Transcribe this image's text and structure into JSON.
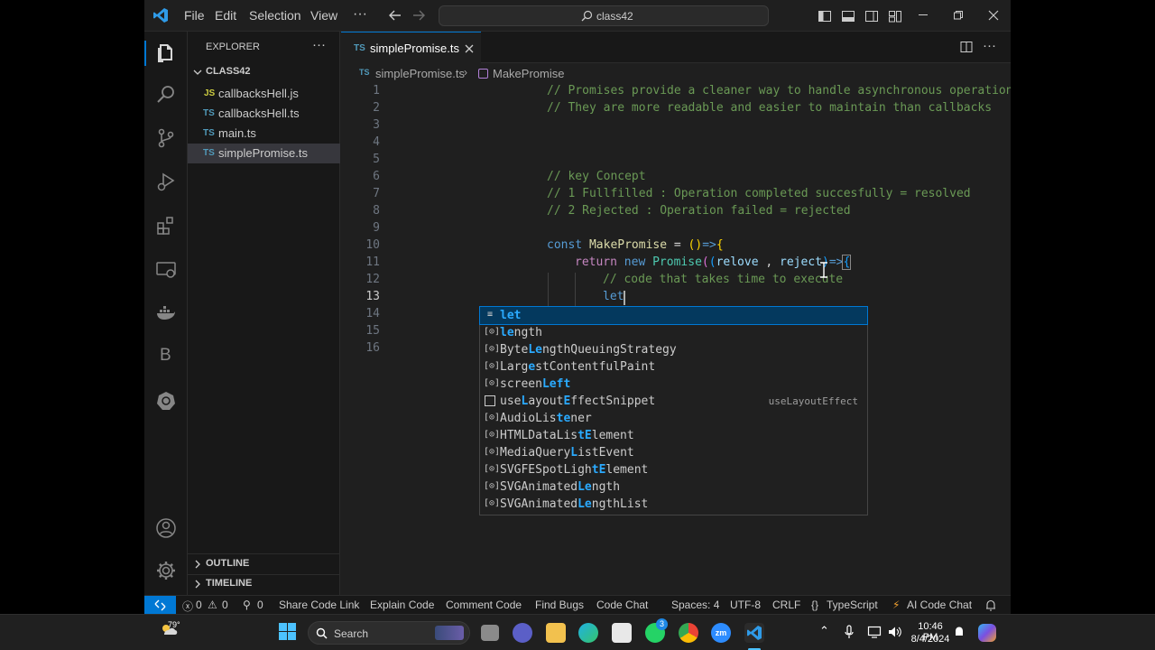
{
  "menu": [
    "File",
    "Edit",
    "Selection",
    "View"
  ],
  "command_center": "class42",
  "explorer": {
    "title": "EXPLORER",
    "folder": "CLASS42",
    "files": [
      {
        "badge": "JS",
        "name": "callbacksHell.js",
        "color": "#cbcb41"
      },
      {
        "badge": "TS",
        "name": "callbacksHell.ts",
        "color": "#519aba"
      },
      {
        "badge": "TS",
        "name": "main.ts",
        "color": "#519aba"
      },
      {
        "badge": "TS",
        "name": "simplePromise.ts",
        "color": "#519aba"
      }
    ],
    "outline": "OUTLINE",
    "timeline": "TIMELINE"
  },
  "tab": {
    "badge": "TS",
    "name": "simplePromise.ts"
  },
  "breadcrumb": {
    "file": "simplePromise.ts",
    "symbol": "MakePromise"
  },
  "code": {
    "line1": "// Promises provide a cleaner way to handle asynchronous operations",
    "line2": "// They are more readable and easier to maintain than callbacks",
    "line6": "// key Concept",
    "line7": "// 1 Fullfilled : Operation completed succesfully = resolved",
    "line8": "// 2 Rejected : Operation failed = rejected",
    "line10": {
      "kw": "const",
      "name": "MakePromise",
      "eq": " = ",
      "paren": "()",
      "arrow": "=>",
      "brace": "{"
    },
    "line11": {
      "kw": "return",
      "new": "new",
      "cls": "Promise",
      "p1": "(",
      "p2": "(",
      "a": "relove",
      "comma": " , ",
      "b": "reject",
      "p3": ")",
      "arrow": "=>",
      "brace": "{"
    },
    "line12": "// code that takes time to execute",
    "line13": "let",
    "line14": {
      "brace": "}",
      "paren": ")"
    },
    "line15": "}"
  },
  "suggestions": [
    {
      "pre": "",
      "hl": "let",
      "post": "",
      "icon": "keyword",
      "detail": ""
    },
    {
      "pre": "",
      "hl": "le",
      "post": "ngth",
      "icon": "variable",
      "detail": ""
    },
    {
      "pre": "Byte",
      "hl": "Le",
      "post": "ngthQueuingStrategy",
      "icon": "variable",
      "detail": ""
    },
    {
      "pre": "Larg",
      "hl": "e",
      "post": "stContentfulPaint",
      "icon": "variable",
      "detail": ""
    },
    {
      "pre": "screen",
      "hl": "Left",
      "post": "",
      "icon": "variable",
      "detail": ""
    },
    {
      "pre": "use",
      "hl": "L",
      "post": "ayout",
      "icon": "snippet",
      "detail": "useLayoutEffect"
    },
    {
      "pre": "AudioLis",
      "hl": "te",
      "post": "ner",
      "icon": "variable",
      "detail": ""
    },
    {
      "pre": "HTMLDataLis",
      "hl": "tE",
      "post": "lement",
      "icon": "variable",
      "detail": ""
    },
    {
      "pre": "MediaQuery",
      "hl": "L",
      "post": "istEvent",
      "icon": "variable",
      "detail": ""
    },
    {
      "pre": "SVGFESpotLigh",
      "hl": "tE",
      "post": "lement",
      "icon": "variable",
      "detail": ""
    },
    {
      "pre": "SVGAnimated",
      "hl": "Le",
      "post": "ngth",
      "icon": "variable",
      "detail": ""
    },
    {
      "pre": "SVGAnimated",
      "hl": "Le",
      "post": "ngthList",
      "icon": "variable",
      "detail": ""
    }
  ],
  "status": {
    "errors": "0",
    "warnings": "0",
    "ports": "0",
    "items": [
      "Share Code Link",
      "Explain Code",
      "Comment Code",
      "Find Bugs",
      "Code Chat"
    ],
    "spaces": "Spaces: 4",
    "encoding": "UTF-8",
    "eol": "CRLF",
    "language": "TypeScript",
    "ai": "AI Code Chat"
  },
  "taskbar": {
    "weather": "79°",
    "search": "Search",
    "time": "10:46 PM",
    "date": "8/4/2024",
    "whatsapp_badge": "3"
  }
}
